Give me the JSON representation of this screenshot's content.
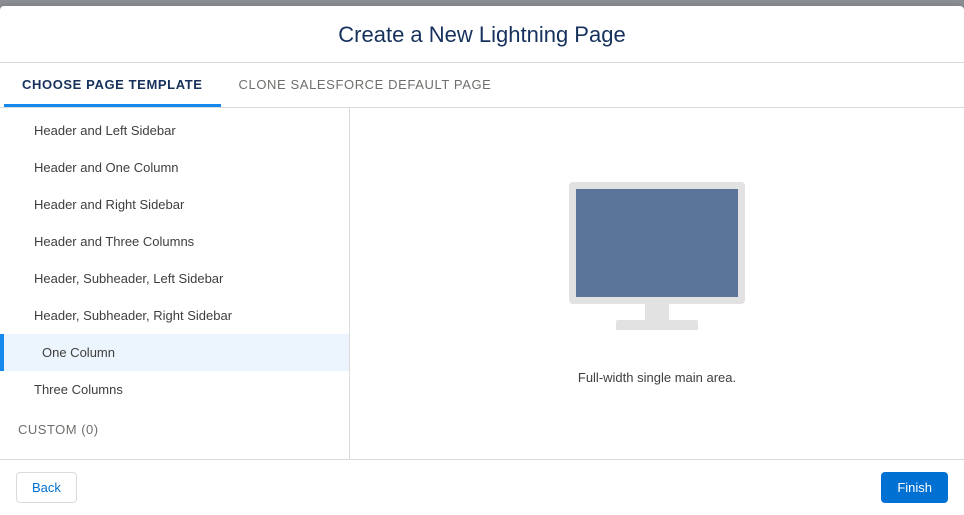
{
  "title": "Create a New Lightning Page",
  "tabs": {
    "choose": "CHOOSE PAGE TEMPLATE",
    "clone": "CLONE SALESFORCE DEFAULT PAGE"
  },
  "templates": [
    "Header and Left Sidebar",
    "Header and One Column",
    "Header and Right Sidebar",
    "Header and Three Columns",
    "Header, Subheader, Left Sidebar",
    "Header, Subheader, Right Sidebar",
    "One Column",
    "Three Columns"
  ],
  "selected_template_index": 6,
  "custom_label": "CUSTOM (0)",
  "preview": {
    "description": "Full-width single main area."
  },
  "buttons": {
    "back": "Back",
    "finish": "Finish"
  },
  "colors": {
    "accent": "#1589ee",
    "primary_btn": "#0070d2",
    "screen": "#5b749a"
  }
}
